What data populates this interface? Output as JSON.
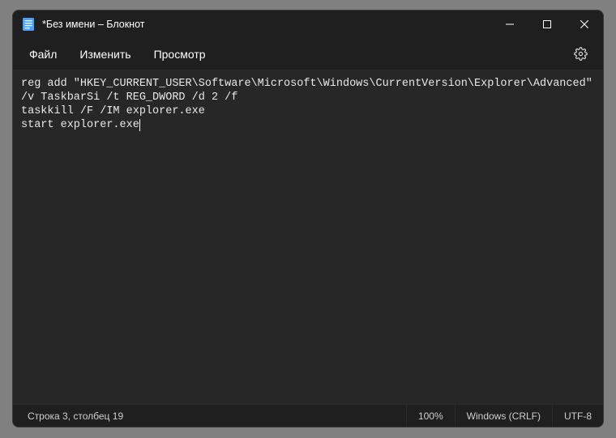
{
  "titlebar": {
    "title": "*Без имени – Блокнот"
  },
  "menu": {
    "file": "Файл",
    "edit": "Изменить",
    "view": "Просмотр"
  },
  "editor": {
    "content": "reg add \"HKEY_CURRENT_USER\\Software\\Microsoft\\Windows\\CurrentVersion\\Explorer\\Advanced\" /v TaskbarSi /t REG_DWORD /d 2 /f\ntaskkill /F /IM explorer.exe\nstart explorer.exe"
  },
  "status": {
    "position": "Строка 3, столбец 19",
    "zoom": "100%",
    "lineending": "Windows (CRLF)",
    "encoding": "UTF-8"
  }
}
